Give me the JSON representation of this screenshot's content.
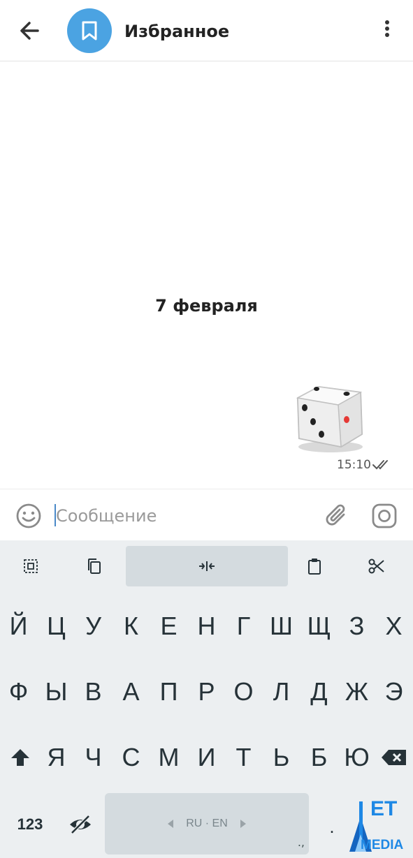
{
  "header": {
    "back_icon": "arrow-left-icon",
    "avatar_icon": "bookmark-icon",
    "title": "Избранное",
    "menu_icon": "more-vertical-icon"
  },
  "chat": {
    "date_separator": "7 февраля",
    "message": {
      "type": "sticker",
      "sticker_icon": "dice-icon",
      "time": "15:10",
      "status_icon": "double-check-icon"
    }
  },
  "composer": {
    "emoji_icon": "emoji-icon",
    "placeholder": "Сообщение",
    "attach_icon": "paperclip-icon",
    "camera_icon": "instagram-camera-icon"
  },
  "keyboard": {
    "toolbar": [
      "select-all-icon",
      "copy-icon",
      "cursor-move-icon",
      "paste-icon",
      "cut-icon"
    ],
    "rows": [
      [
        "Й",
        "Ц",
        "У",
        "К",
        "Е",
        "Н",
        "Г",
        "Ш",
        "Щ",
        "З",
        "Х"
      ],
      [
        "Ф",
        "Ы",
        "В",
        "А",
        "П",
        "Р",
        "О",
        "Л",
        "Д",
        "Ж",
        "Э"
      ],
      [
        "Я",
        "Ч",
        "С",
        "М",
        "И",
        "Т",
        "Ь",
        "Б",
        "Ю"
      ]
    ],
    "numbers_label": "123",
    "space_label": "RU · EN",
    "space_punct": ".,",
    "period_label": ".",
    "colors": {
      "background": "#eceff1",
      "key_highlight": "#d4dbdf",
      "accent": "#4ba3e2"
    }
  },
  "watermark": {
    "text_top": "ET",
    "text_bottom": "MEDIA"
  }
}
